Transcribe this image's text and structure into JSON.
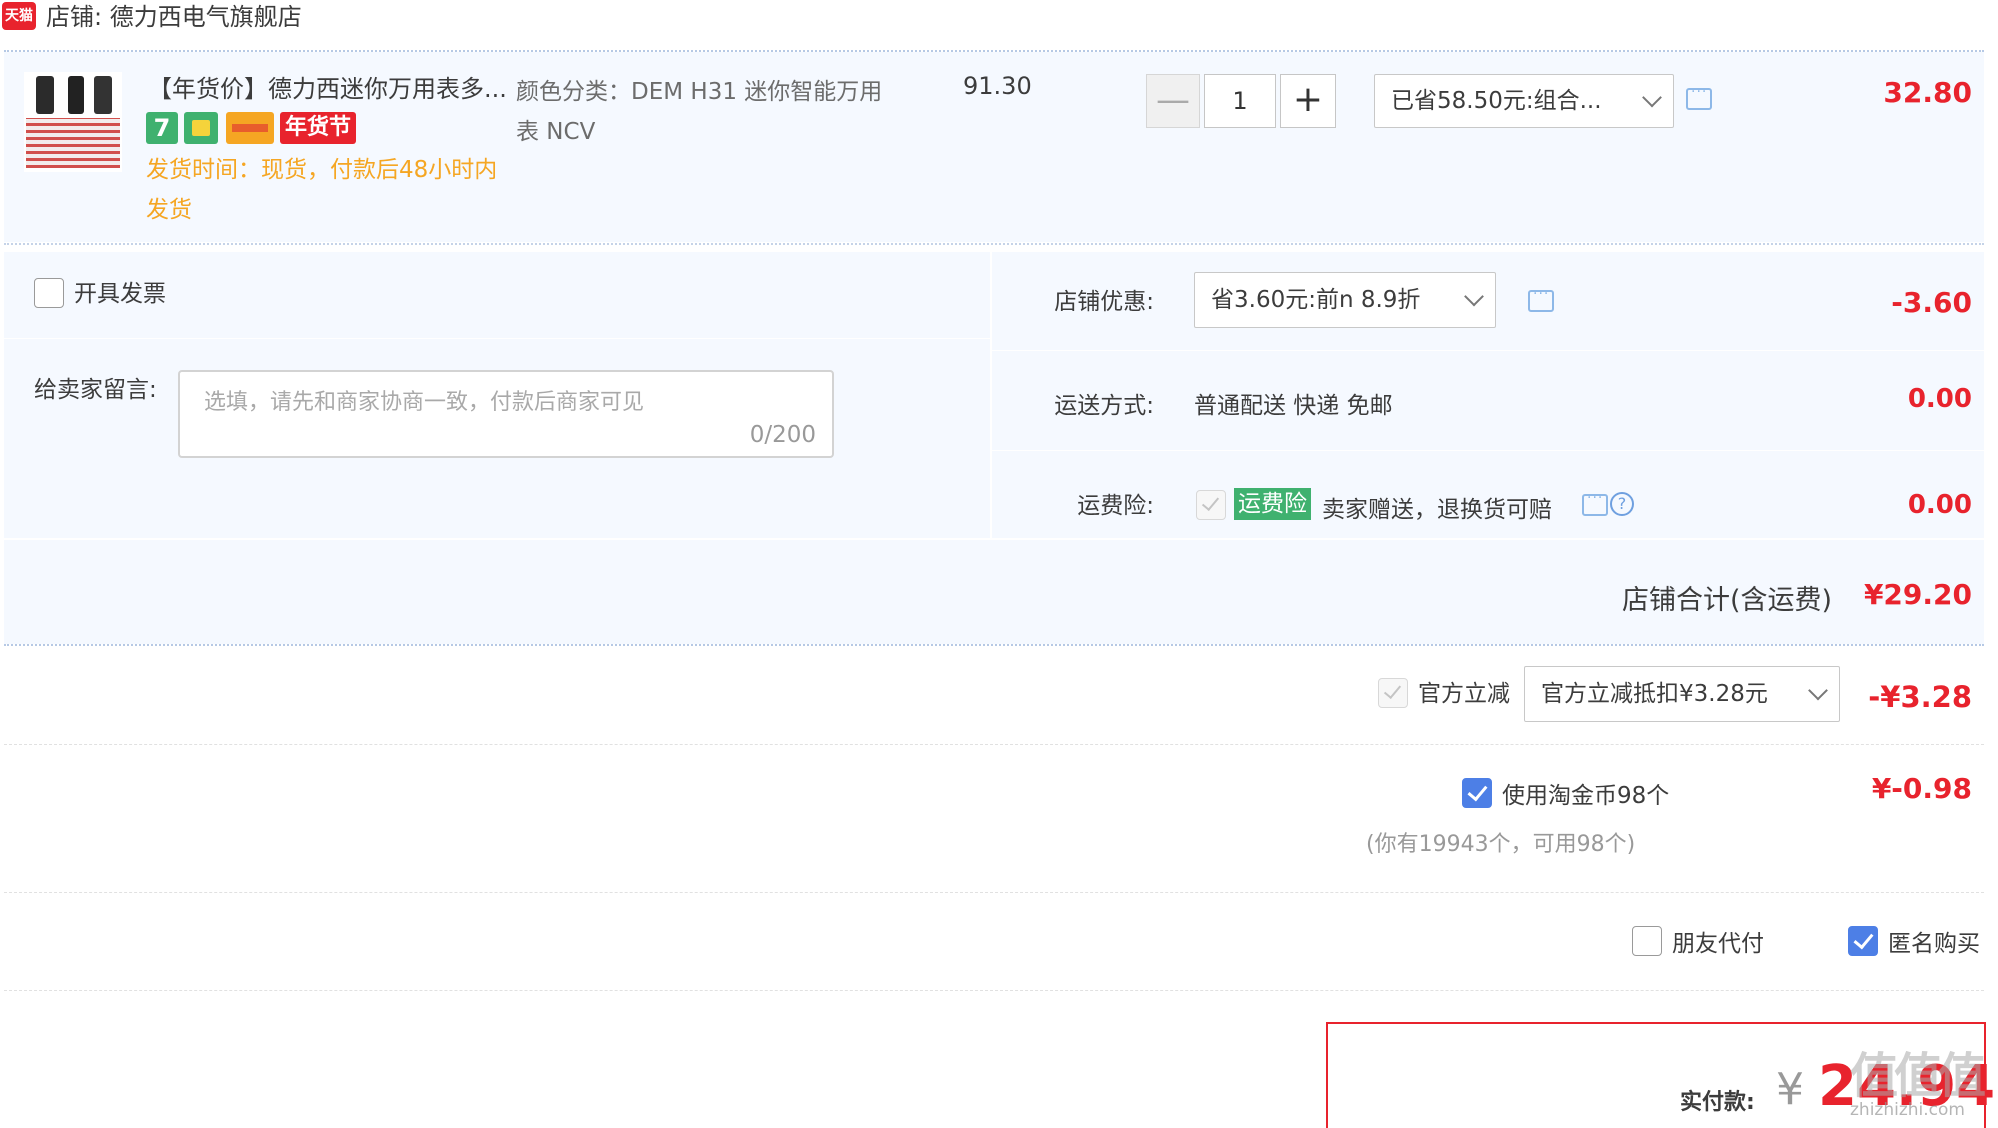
{
  "shop": {
    "platform_badge": "天猫",
    "label": "店铺: 德力西电气旗舰店"
  },
  "item": {
    "title": "【年货价】德力西迷你万用表多...",
    "badges": {
      "seven": "7",
      "festival": "年货节"
    },
    "ship_time": "发货时间：现货，付款后48小时内发货",
    "sku": "颜色分类：DEM H31 迷你智能万用表 NCV",
    "price": "91.30",
    "quantity": {
      "minus": "—",
      "value": "1",
      "plus": "+"
    },
    "combo_discount": "已省58.50元:组合...",
    "total": "32.80"
  },
  "options": {
    "invoice_label": "开具发票",
    "message_label": "给卖家留言:",
    "message_placeholder": "选填，请先和商家协商一致，付款后商家可见",
    "message_count": "0/200",
    "store_discount_label": "店铺优惠:",
    "store_discount_select": "省3.60元:前n 8.9折",
    "store_discount_value": "-3.60",
    "shipping_label": "运送方式:",
    "shipping_value": "普通配送 快递 免邮",
    "shipping_fee": "0.00",
    "insurance_label": "运费险:",
    "insurance_tag": "运费险",
    "insurance_desc": "卖家赠送，退换货可赔",
    "insurance_fee": "0.00",
    "help_glyph": "?"
  },
  "store_total": {
    "label": "店铺合计(含运费)",
    "value": "¥29.20"
  },
  "official": {
    "label": "官方立减",
    "select": "官方立减抵扣¥3.28元",
    "value": "-¥3.28"
  },
  "coins": {
    "label": "使用淘金币98个",
    "sub": "(你有19943个，可用98个)",
    "value": "¥-0.98",
    "checked": true
  },
  "extras": {
    "friend_pay_label": "朋友代付",
    "anonymous_label": "匿名购买",
    "anonymous_checked": true
  },
  "payment": {
    "label": "实付款:",
    "currency": "¥",
    "amount": "24.94"
  },
  "watermark": {
    "logo": "值值值",
    "text": "zhizhizhi.com"
  },
  "colors": {
    "accent_red": "#e8232d",
    "tag_green": "#3fb16f",
    "row_bg": "#f5f9ff",
    "check_blue": "#4d7fe6",
    "ship_orange": "#f5a623"
  }
}
